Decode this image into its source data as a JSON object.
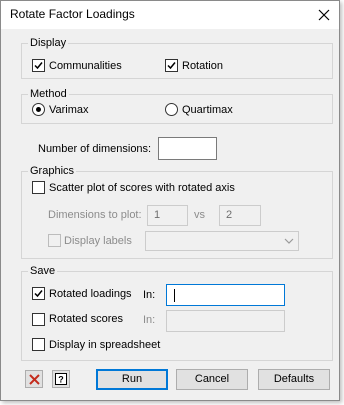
{
  "window": {
    "title": "Rotate Factor Loadings"
  },
  "display": {
    "legend": "Display",
    "communalities": {
      "label": "Communalities",
      "checked": true
    },
    "rotation": {
      "label": "Rotation",
      "checked": true
    }
  },
  "method": {
    "legend": "Method",
    "options": [
      {
        "label": "Varimax",
        "selected": true
      },
      {
        "label": "Quartimax",
        "selected": false
      }
    ]
  },
  "dimensions": {
    "label": "Number of dimensions:",
    "value": ""
  },
  "graphics": {
    "legend": "Graphics",
    "scatter": {
      "label": "Scatter plot of scores with rotated axis",
      "checked": false
    },
    "dims_label": "Dimensions to plot:",
    "dim1": "1",
    "vs_label": "vs",
    "dim2": "2",
    "display_labels": {
      "label": "Display labels",
      "checked": false
    },
    "labels_select_value": ""
  },
  "save": {
    "legend": "Save",
    "loadings": {
      "label": "Rotated loadings",
      "checked": true,
      "in_label": "In:",
      "value": ""
    },
    "scores": {
      "label": "Rotated scores",
      "checked": false,
      "in_label": "In:",
      "value": ""
    },
    "spreadsheet": {
      "label": "Display in spreadsheet",
      "checked": false
    }
  },
  "buttons": {
    "run": "Run",
    "cancel": "Cancel",
    "defaults": "Defaults"
  },
  "colors": {
    "accent": "#0078d7",
    "clear_icon": "#c42b1c"
  },
  "icons": {
    "close": "close-icon",
    "clear": "clear-x-icon",
    "help": "help-icon"
  }
}
